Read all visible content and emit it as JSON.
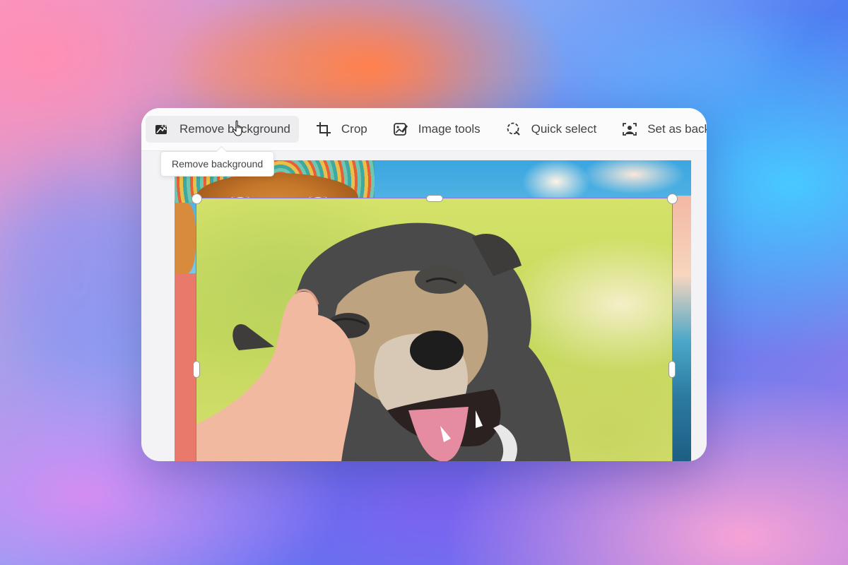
{
  "toolbar": {
    "items": [
      {
        "label": "Remove background",
        "icon": "remove-background-icon"
      },
      {
        "label": "Crop",
        "icon": "crop-icon"
      },
      {
        "label": "Image tools",
        "icon": "image-tools-icon"
      },
      {
        "label": "Quick select",
        "icon": "quick-select-icon"
      },
      {
        "label": "Set as backg",
        "icon": "set-as-background-icon"
      }
    ],
    "active_index": 0
  },
  "tooltip": {
    "text": "Remove background"
  },
  "colors": {
    "card_background": "#f5f4f6",
    "toolbar_background": "#fbfbfc",
    "selection_border": "#8b74d9",
    "text": "#424242"
  }
}
